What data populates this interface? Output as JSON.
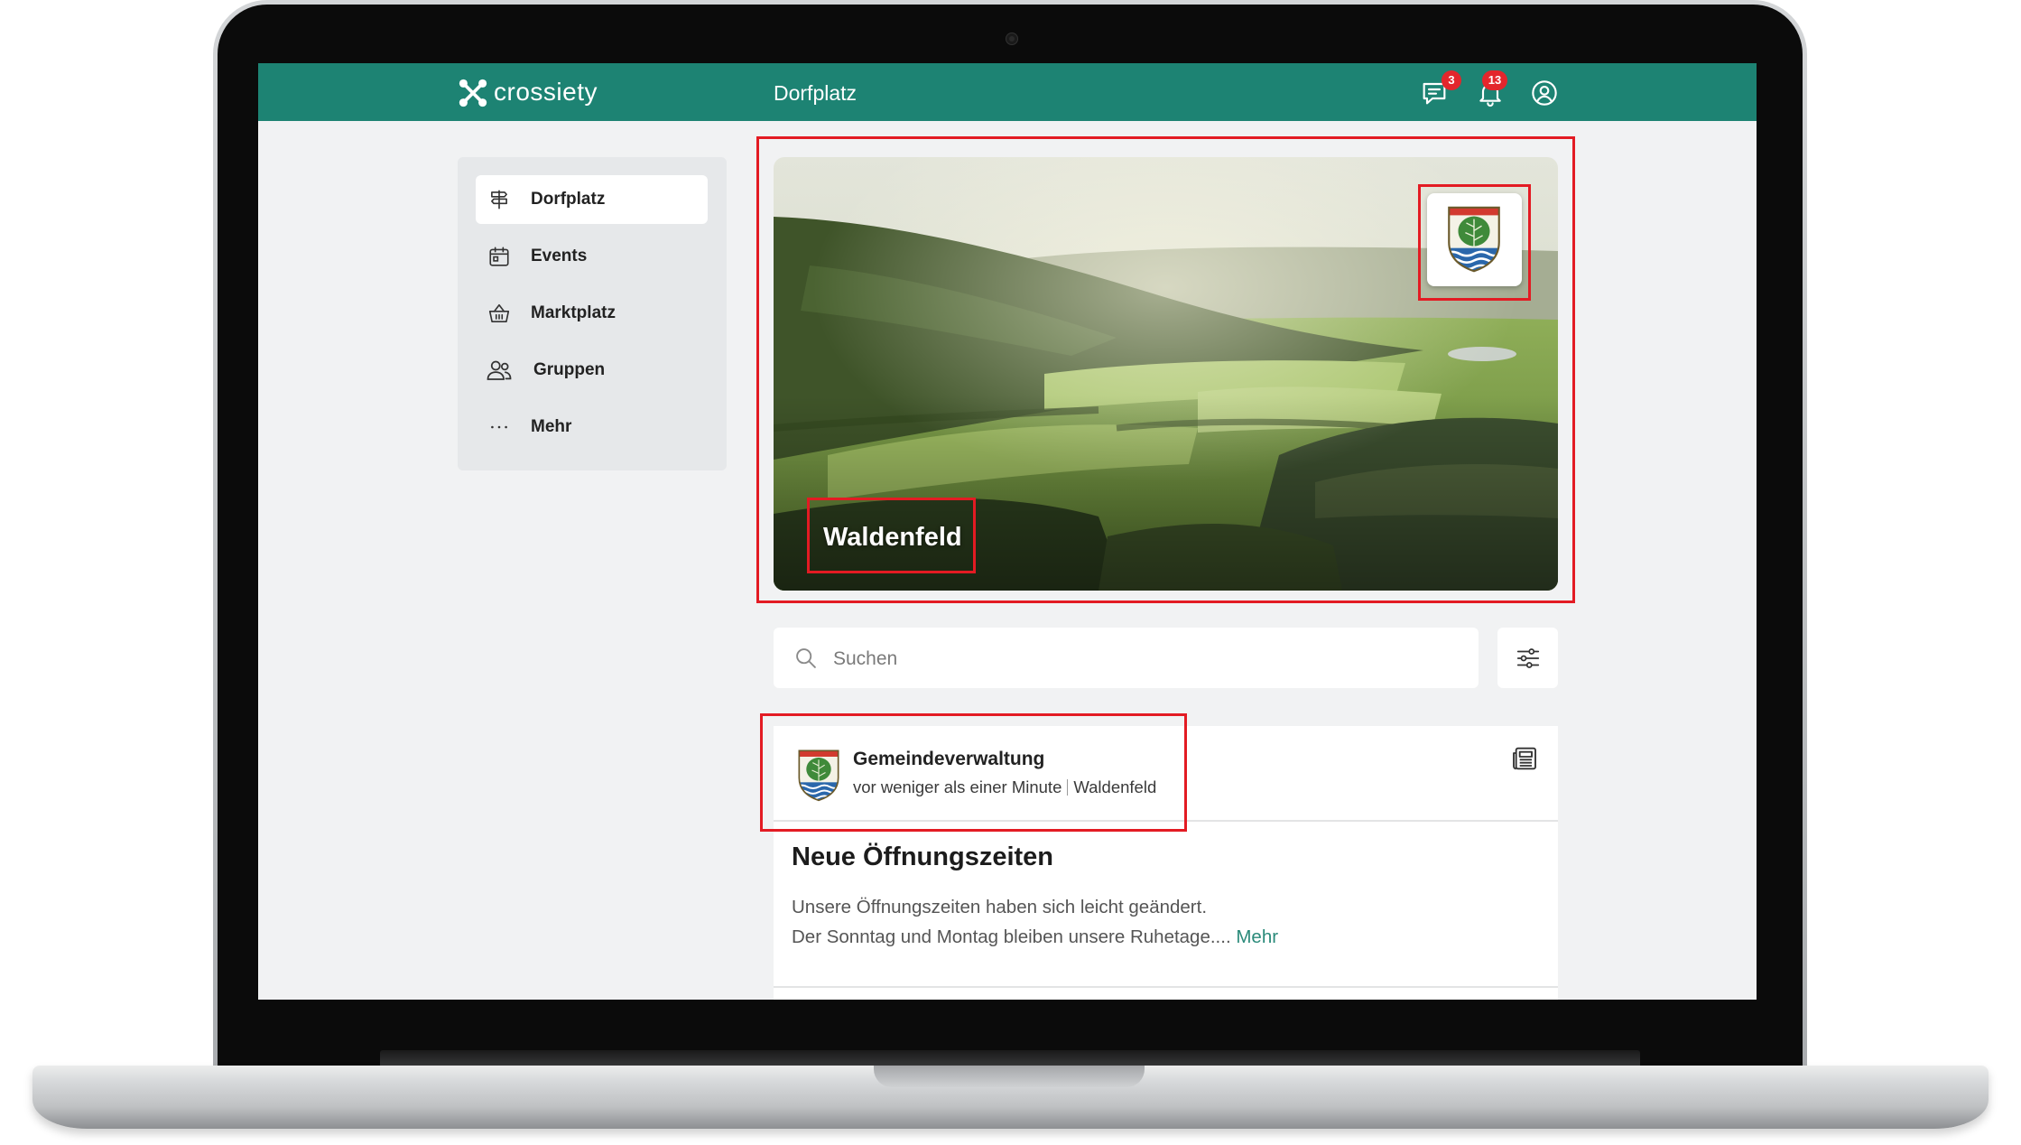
{
  "header": {
    "brand": "crossiety",
    "title": "Dorfplatz",
    "chat_badge": "3",
    "notification_badge": "13"
  },
  "sidebar": {
    "items": [
      {
        "label": "Dorfplatz",
        "icon": "signpost-icon",
        "active": true
      },
      {
        "label": "Events",
        "icon": "calendar-icon",
        "active": false
      },
      {
        "label": "Marktplatz",
        "icon": "basket-icon",
        "active": false
      },
      {
        "label": "Gruppen",
        "icon": "users-icon",
        "active": false
      },
      {
        "label": "Mehr",
        "icon": "more-dots-icon",
        "active": false
      }
    ]
  },
  "hero": {
    "community_name": "Waldenfeld",
    "emblem": "coat-of-arms-icon"
  },
  "search": {
    "placeholder": "Suchen"
  },
  "post": {
    "author": "Gemeindeverwaltung",
    "time": "vor weniger als einer Minute",
    "location": "Waldenfeld",
    "type_icon": "newspaper-icon",
    "title": "Neue Öffnungszeiten",
    "body_line1": "Unsere Öffnungszeiten haben sich leicht geändert.",
    "body_line2": "Der Sonntag und Montag bleiben unsere Ruhetage....",
    "more_link": "Mehr"
  },
  "colors": {
    "brand_teal": "#1d8373",
    "badge_red": "#e3262c",
    "highlight_red": "#e31b23",
    "link_teal": "#2a8a7a",
    "page_background": "#f1f2f3"
  }
}
